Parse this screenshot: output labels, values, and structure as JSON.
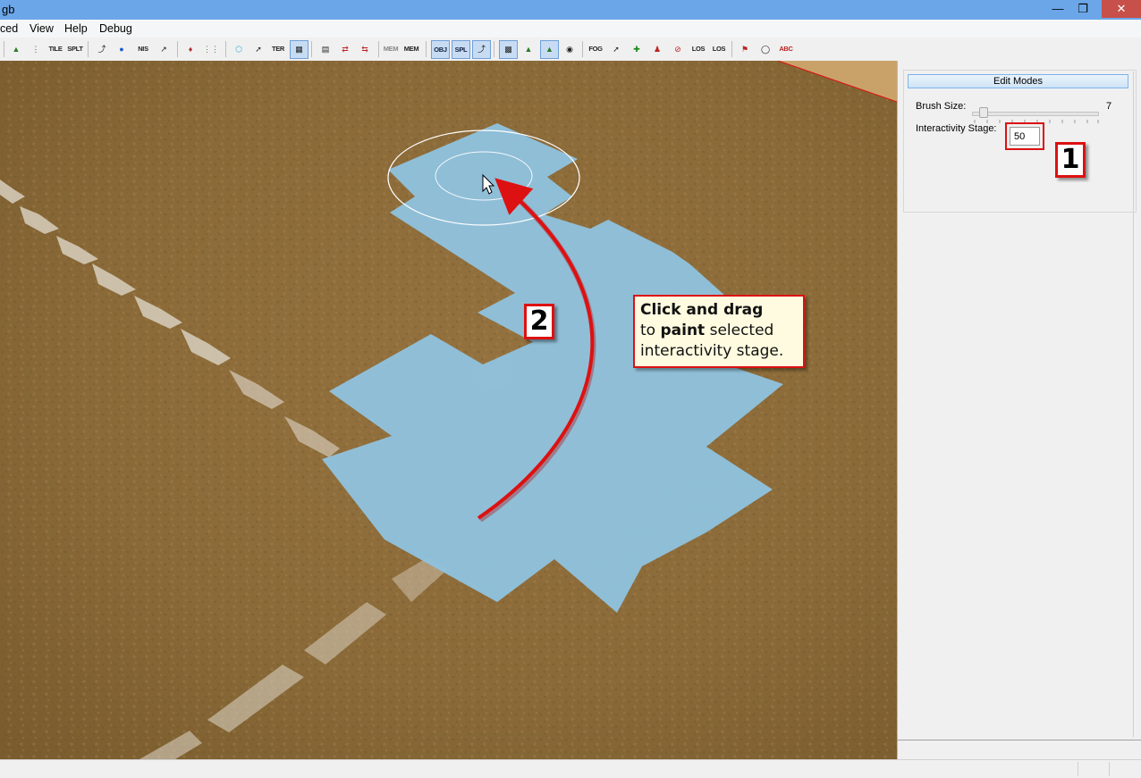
{
  "window": {
    "title": "gb"
  },
  "menu": {
    "items": [
      "ced",
      "View",
      "Help",
      "Debug"
    ]
  },
  "toolbar": {
    "labels": {
      "tile": "TILE",
      "splt": "SPLT",
      "nis": "NIS",
      "ter": "TER",
      "memdmp": "MEM DMP",
      "memstat": "MEM STAT",
      "obj": "OBJ",
      "spl": "SPL",
      "fog": "FOG",
      "los1": "LOS",
      "los2": "LOS",
      "abc": "ABC"
    }
  },
  "annotation": {
    "line1_bold": "Click and drag",
    "line2_prefix": "to ",
    "line2_bold": "paint",
    "line2_suffix": " selected",
    "line3": "interactivity stage.",
    "badge_paint": "2",
    "badge_input": "1"
  },
  "panel": {
    "edit_modes_label": "Edit Modes",
    "brush_size_label": "Brush Size:",
    "brush_size_value": "7",
    "brush_size_level": 7,
    "interactivity_stage_label": "Interactivity Stage:",
    "interactivity_stage_value": "50"
  },
  "colors": {
    "paint_overlay": "#8fc1dc",
    "ground": "#8f6d3a",
    "callout_border": "#dd1111",
    "titlebar": "#6ba6e8"
  }
}
